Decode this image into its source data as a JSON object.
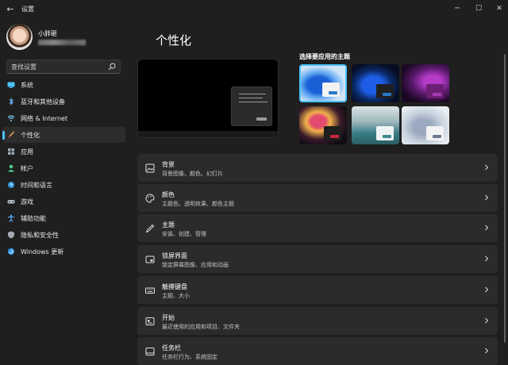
{
  "window": {
    "title": "设置",
    "back_icon": "arrow-left-icon",
    "minimize_icon": "minimize-icon",
    "maximize_icon": "maximize-icon",
    "close_icon": "close-icon"
  },
  "user": {
    "name": "小胖砸"
  },
  "search": {
    "placeholder": "查找设置"
  },
  "sidebar": {
    "items": [
      {
        "label": "系统",
        "icon": "monitor-icon",
        "active": false
      },
      {
        "label": "蓝牙和其他设备",
        "icon": "bluetooth-icon",
        "active": false
      },
      {
        "label": "网络 & Internet",
        "icon": "wifi-icon",
        "active": false
      },
      {
        "label": "个性化",
        "icon": "brush-icon",
        "active": true
      },
      {
        "label": "应用",
        "icon": "apps-icon",
        "active": false
      },
      {
        "label": "帐户",
        "icon": "person-icon",
        "active": false
      },
      {
        "label": "时间和语言",
        "icon": "globe-clock-icon",
        "active": false
      },
      {
        "label": "游戏",
        "icon": "gamepad-icon",
        "active": false
      },
      {
        "label": "辅助功能",
        "icon": "accessibility-icon",
        "active": false
      },
      {
        "label": "隐私和安全性",
        "icon": "shield-icon",
        "active": false
      },
      {
        "label": "Windows 更新",
        "icon": "update-icon",
        "active": false
      }
    ]
  },
  "main": {
    "title": "个性化",
    "themes_title": "选择要应用的主题",
    "themes": [
      {
        "name": "windows-light-bloom",
        "selected": true
      },
      {
        "name": "windows-dark-bloom",
        "selected": false
      },
      {
        "name": "glow-purple",
        "selected": false
      },
      {
        "name": "captured-motion",
        "selected": false
      },
      {
        "name": "sunrise-lake",
        "selected": false
      },
      {
        "name": "flow-gray",
        "selected": false
      }
    ],
    "cards": [
      {
        "title": "背景",
        "subtitle": "背景图像、颜色、幻灯片",
        "icon": "image-icon"
      },
      {
        "title": "颜色",
        "subtitle": "主题色、透明效果、颜色主题",
        "icon": "palette-icon"
      },
      {
        "title": "主题",
        "subtitle": "安装、创建、管理",
        "icon": "pen-icon"
      },
      {
        "title": "锁屏界面",
        "subtitle": "锁定屏幕图像、应用和动画",
        "icon": "lock-screen-icon"
      },
      {
        "title": "触摸键盘",
        "subtitle": "主题、大小",
        "icon": "keyboard-icon"
      },
      {
        "title": "开始",
        "subtitle": "最近使用的应用和项目、文件夹",
        "icon": "start-icon"
      },
      {
        "title": "任务栏",
        "subtitle": "任务栏行为、系统固定",
        "icon": "taskbar-icon"
      }
    ]
  },
  "colors": {
    "background": "#1f1f1f",
    "card": "#2b2b2b",
    "accent": "#4cc2ff"
  }
}
